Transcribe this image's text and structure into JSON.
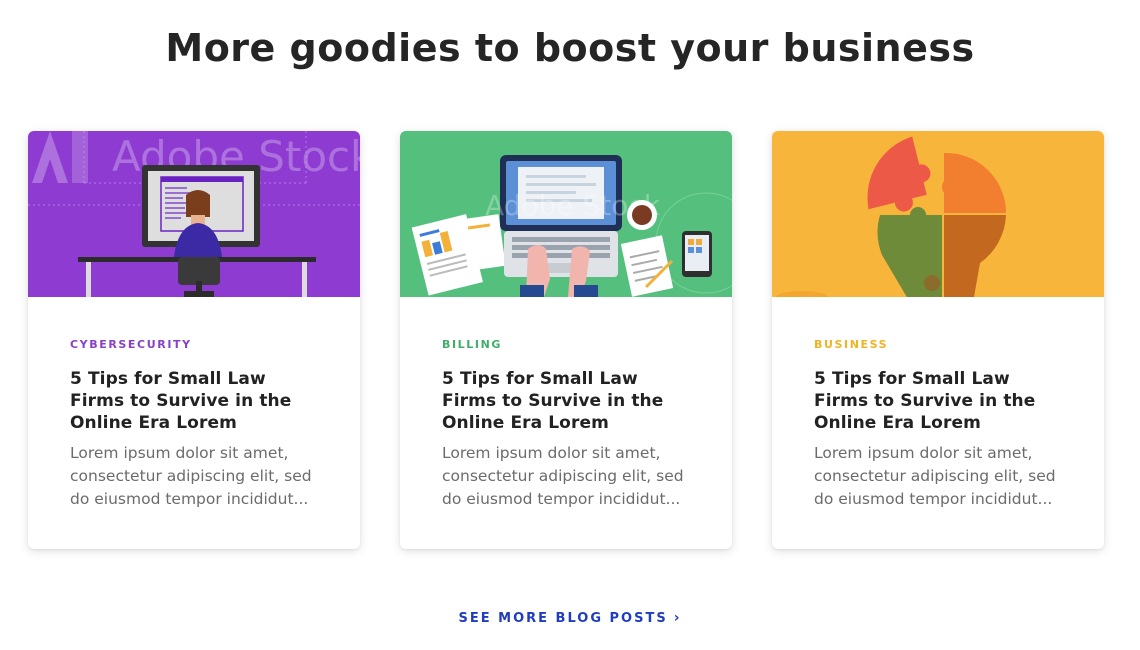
{
  "section": {
    "title": "More goodies to boost your business"
  },
  "cards": [
    {
      "category": "CYBERSECURITY",
      "category_color": "#8a3fc7",
      "image_bg": "#8e3bd1",
      "image_subject": "person-at-computer-illustration",
      "watermark": "Adobe Stock",
      "title": "5 Tips for Small Law Firms to Survive in the Online Era Lorem",
      "excerpt": "Lorem ipsum dolor sit amet, consectetur adipiscing elit, sed do eiusmod tempor incididut..."
    },
    {
      "category": "BILLING",
      "category_color": "#3fae6a",
      "image_bg": "#55c07e",
      "image_subject": "laptop-desk-illustration",
      "watermark": "Adobe Stock",
      "title": "5 Tips for Small Law Firms to Survive in the Online Era Lorem",
      "excerpt": "Lorem ipsum dolor sit amet, consectetur adipiscing elit, sed do eiusmod tempor incididut..."
    },
    {
      "category": "BUSINESS",
      "category_color": "#f0b323",
      "image_bg": "#f8b53b",
      "image_subject": "puzzle-lightbulb-illustration",
      "title": "5 Tips for Small Law Firms to Survive in the Online Era Lorem",
      "excerpt": "Lorem ipsum dolor sit amet, consectetur adipiscing elit, sed do eiusmod tempor incididut..."
    }
  ],
  "see_more": {
    "label": "SEE MORE BLOG POSTS",
    "icon": "chevron-right-icon",
    "color": "#1f3dbf"
  }
}
